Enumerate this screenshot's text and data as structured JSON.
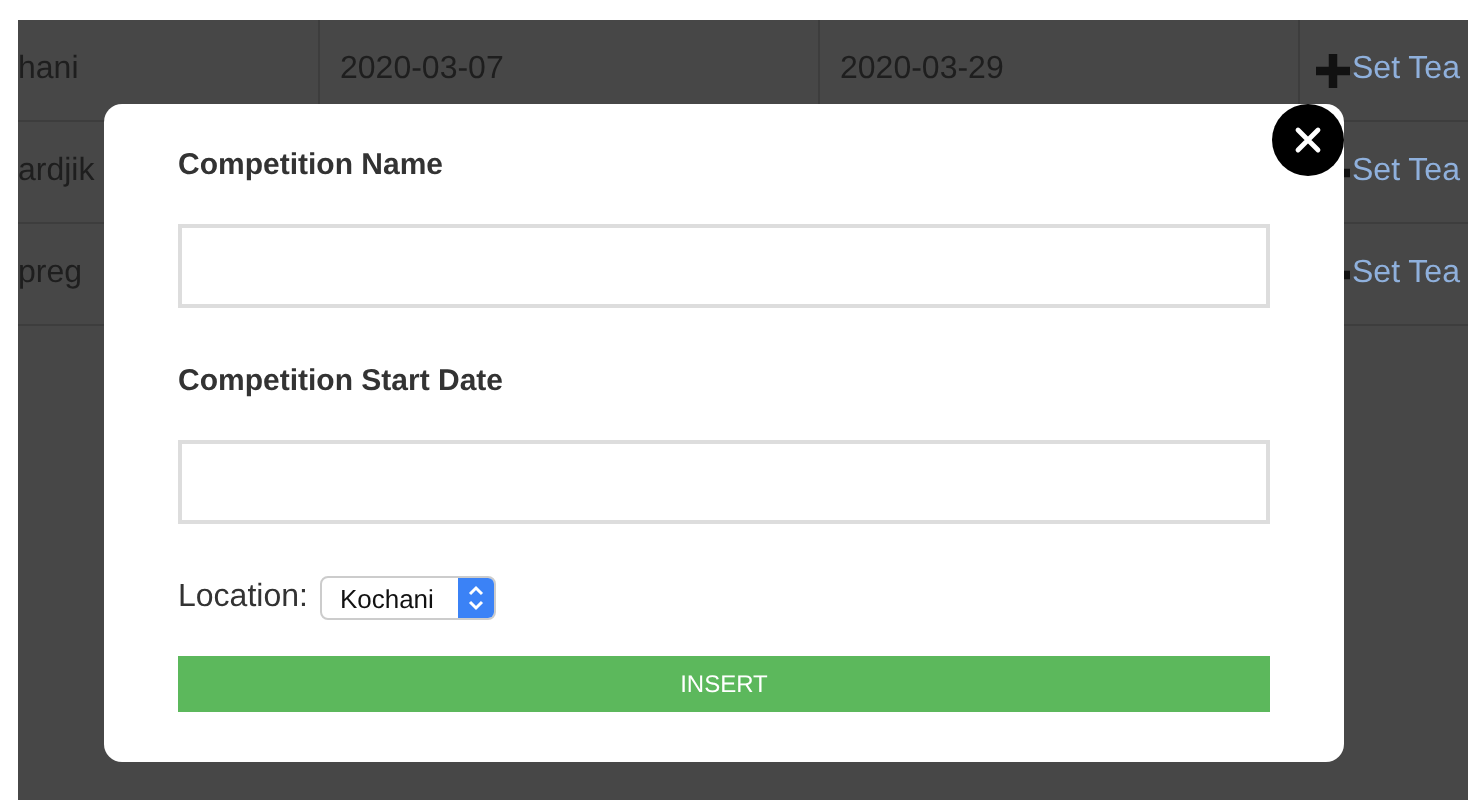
{
  "table": {
    "rows": [
      {
        "cells": [
          "hani",
          "2020-03-07",
          "2020-03-29"
        ],
        "action": "Set Tea"
      },
      {
        "cells": [
          "ardjik"
        ],
        "action": "Set Tea"
      },
      {
        "cells": [
          "preg"
        ],
        "action": "Set Tea"
      }
    ]
  },
  "modal": {
    "fields": [
      {
        "label": "Competition Name"
      },
      {
        "label": "Competition Start Date"
      }
    ],
    "location": {
      "label": "Location:",
      "value": "Kochani"
    },
    "submit": "INSERT"
  }
}
